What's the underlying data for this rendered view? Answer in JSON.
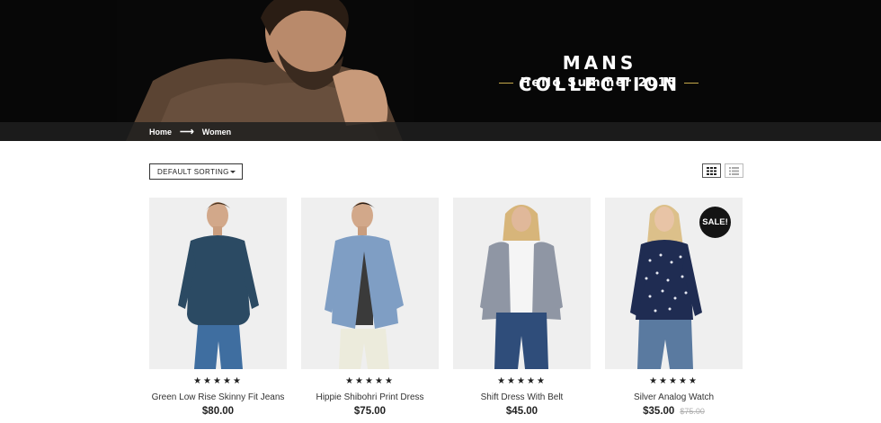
{
  "hero": {
    "title": "MANS COLLECTION",
    "subtitle": "Hello Summer 2015"
  },
  "breadcrumb": {
    "home": "Home",
    "arrow": "⟶",
    "current": "Women"
  },
  "toolbar": {
    "sort_label": "DEFAULT SORTING",
    "views": [
      "grid-view-icon",
      "list-view-icon"
    ],
    "active_view": "grid"
  },
  "products": [
    {
      "name": "Green Low Rise Skinny Fit Jeans",
      "price": "$80.00",
      "stars": "★★★★★",
      "rating": 5,
      "sweater": "#2b4a63",
      "pants": "#3f6ea0",
      "hair": "#4a3320"
    },
    {
      "name": "Hippie Shibohri Print Dress",
      "price": "$75.00",
      "stars": "★★★★★",
      "rating": 5,
      "jacket": "#7f9ec4",
      "pants": "#ecebdc",
      "hair": "#2a1e16"
    },
    {
      "name": "Shift Dress With Belt",
      "price": "$45.00",
      "stars": "★★★★★",
      "rating": 5,
      "shirt": "#8f96a4",
      "pants": "#2f4d7a",
      "hair": "#d7b57a"
    },
    {
      "name": "Silver Analog Watch",
      "price": "$35.00",
      "old_price": "$75.00",
      "stars": "★★★★★",
      "rating": 5,
      "badge": "SALE!",
      "shirt": "#1f2c52",
      "pants": "#5a7aa0",
      "hair": "#dcc08a"
    }
  ]
}
